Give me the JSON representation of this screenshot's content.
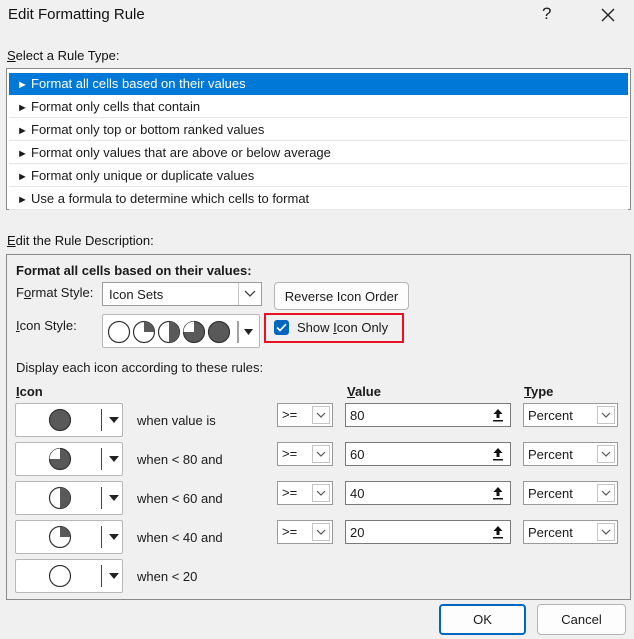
{
  "window": {
    "title": "Edit Formatting Rule",
    "help": "?",
    "close_icon": "close-icon"
  },
  "rule_type": {
    "label": "Select a Rule Type:",
    "items": [
      {
        "label": "Format all cells based on their values",
        "selected": true
      },
      {
        "label": "Format only cells that contain",
        "selected": false
      },
      {
        "label": "Format only top or bottom ranked values",
        "selected": false
      },
      {
        "label": "Format only values that are above or below average",
        "selected": false
      },
      {
        "label": "Format only unique or duplicate values",
        "selected": false
      },
      {
        "label": "Use a formula to determine which cells to format",
        "selected": false
      }
    ]
  },
  "description": {
    "label": "Edit the Rule Description:",
    "heading": "Format all cells based on their values:",
    "format_style_label": "Format Style:",
    "format_style_value": "Icon Sets",
    "reverse_button": "Reverse Icon Order",
    "icon_style_label": "Icon Style:",
    "show_icon_only": {
      "label": "Show Icon Only",
      "checked": true
    },
    "rules_intro": "Display each icon according to these rules:",
    "col_icon": "Icon",
    "col_value": "Value",
    "col_type": "Type",
    "rules": [
      {
        "icon": "circle-full-icon",
        "when": "when value is",
        "op": ">=",
        "value": "80",
        "type": "Percent"
      },
      {
        "icon": "circle-three-quarters-icon",
        "when": "when < 80 and",
        "op": ">=",
        "value": "60",
        "type": "Percent"
      },
      {
        "icon": "circle-half-icon",
        "when": "when < 60 and",
        "op": ">=",
        "value": "40",
        "type": "Percent"
      },
      {
        "icon": "circle-quarter-icon",
        "when": "when < 40 and",
        "op": ">=",
        "value": "20",
        "type": "Percent"
      },
      {
        "icon": "circle-empty-icon",
        "when": "when < 20"
      }
    ]
  },
  "footer": {
    "ok": "OK",
    "cancel": "Cancel"
  },
  "colors": {
    "selection": "#0078d7",
    "highlight_box": "#e81123",
    "checkbox": "#0067c0",
    "icon_fill": "#595959"
  }
}
